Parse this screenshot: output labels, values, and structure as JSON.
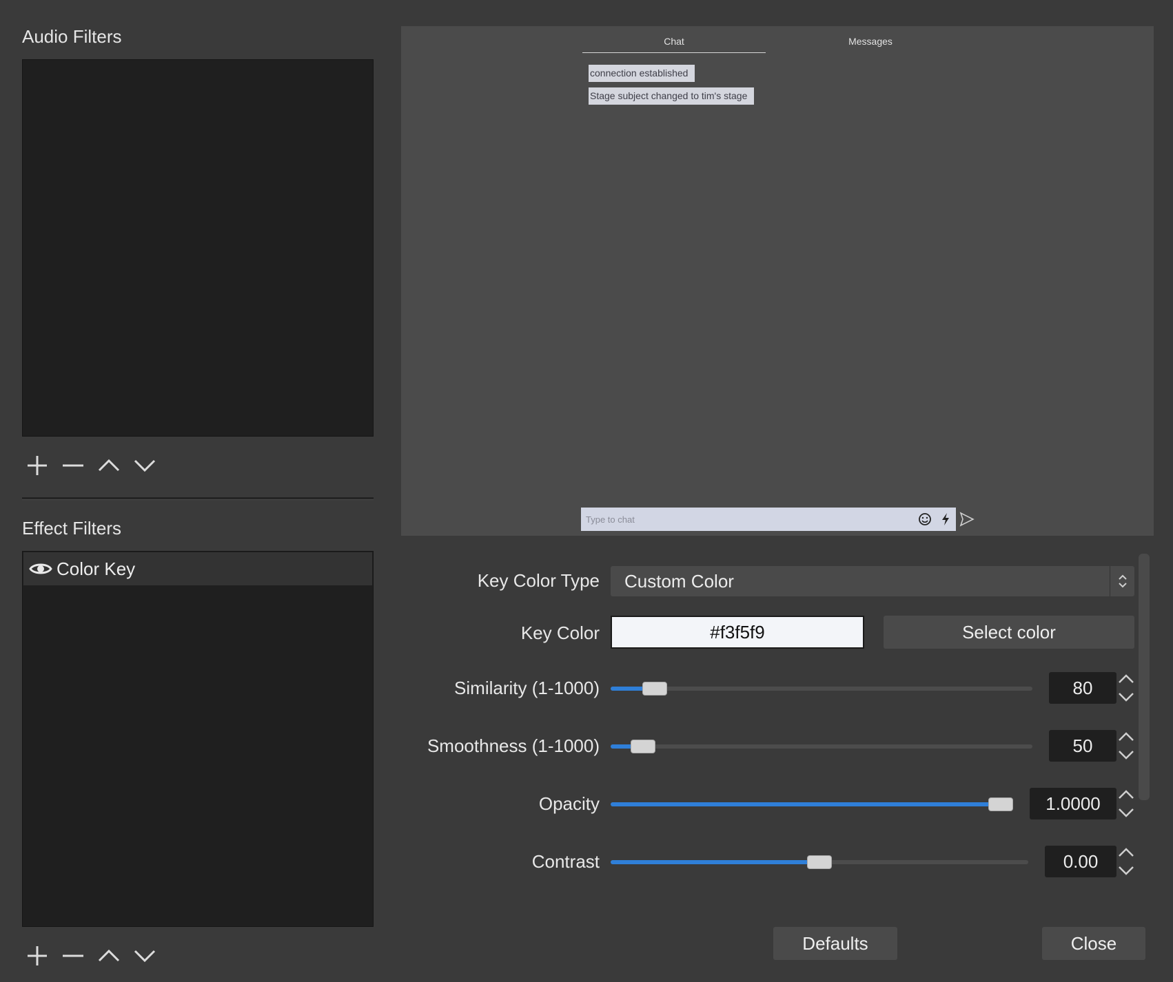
{
  "audio_filters": {
    "title": "Audio Filters",
    "toolbar": [
      "plus-icon",
      "minus-icon",
      "chevron-up-icon",
      "chevron-down-icon"
    ]
  },
  "effect_filters": {
    "title": "Effect Filters",
    "items": [
      {
        "label": "Color Key",
        "icon": "eye-icon",
        "visible": true
      }
    ],
    "toolbar": [
      "plus-icon",
      "minus-icon",
      "chevron-up-icon",
      "chevron-down-icon"
    ]
  },
  "preview": {
    "tabs": [
      {
        "label": "Chat",
        "active": true
      },
      {
        "label": "Messages",
        "active": false
      }
    ],
    "messages": [
      "connection established",
      "Stage subject changed to tim's stage"
    ],
    "chat_input_placeholder": "Type to chat",
    "icons": [
      "emoji-icon",
      "lightning-icon",
      "send-icon"
    ]
  },
  "properties": {
    "key_color_type": {
      "label": "Key Color Type",
      "value": "Custom Color"
    },
    "key_color": {
      "label": "Key Color",
      "value": "#f3f5f9",
      "button": "Select color"
    },
    "similarity": {
      "label": "Similarity (1-1000)",
      "value": "80",
      "level": 0.08
    },
    "smoothness": {
      "label": "Smoothness (1-1000)",
      "value": "50",
      "level": 0.05
    },
    "opacity": {
      "label": "Opacity",
      "value": "1.0000",
      "level": 1.0
    },
    "contrast": {
      "label": "Contrast",
      "value": "0.00",
      "level": 0.5
    }
  },
  "footer": {
    "defaults": "Defaults",
    "close": "Close"
  },
  "colors": {
    "accent": "#2f7fd8",
    "background": "#3a3a3a",
    "list_bg": "#1f1f1f",
    "preview_bg": "#4b4b4b"
  }
}
